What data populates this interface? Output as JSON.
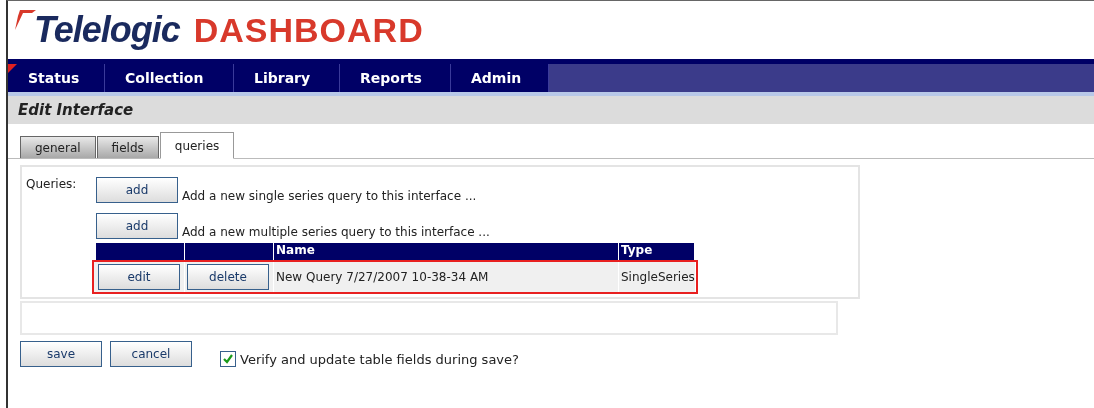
{
  "logo": {
    "brand": "Telelogic",
    "product": "DASHBOARD"
  },
  "nav": [
    "Status",
    "Collection",
    "Library",
    "Reports",
    "Admin"
  ],
  "page_title": "Edit Interface",
  "tabs": [
    {
      "label": "general",
      "selected": false
    },
    {
      "label": "fields",
      "selected": false
    },
    {
      "label": "queries",
      "selected": true
    }
  ],
  "queries": {
    "label": "Queries:",
    "actions": [
      {
        "button": "add",
        "text": "Add a new single series query to this interface ..."
      },
      {
        "button": "add",
        "text": "Add a new multiple series query to this interface ..."
      }
    ],
    "columns": [
      "Name",
      "Type"
    ],
    "rows": [
      {
        "edit": "edit",
        "delete": "delete",
        "name": "New Query 7/27/2007 10-38-34 AM",
        "type": "SingleSeries",
        "highlighted": true
      }
    ]
  },
  "buttons": [
    "save",
    "cancel"
  ],
  "verify": {
    "label": "Verify and update table fields during save?",
    "checked": true
  }
}
